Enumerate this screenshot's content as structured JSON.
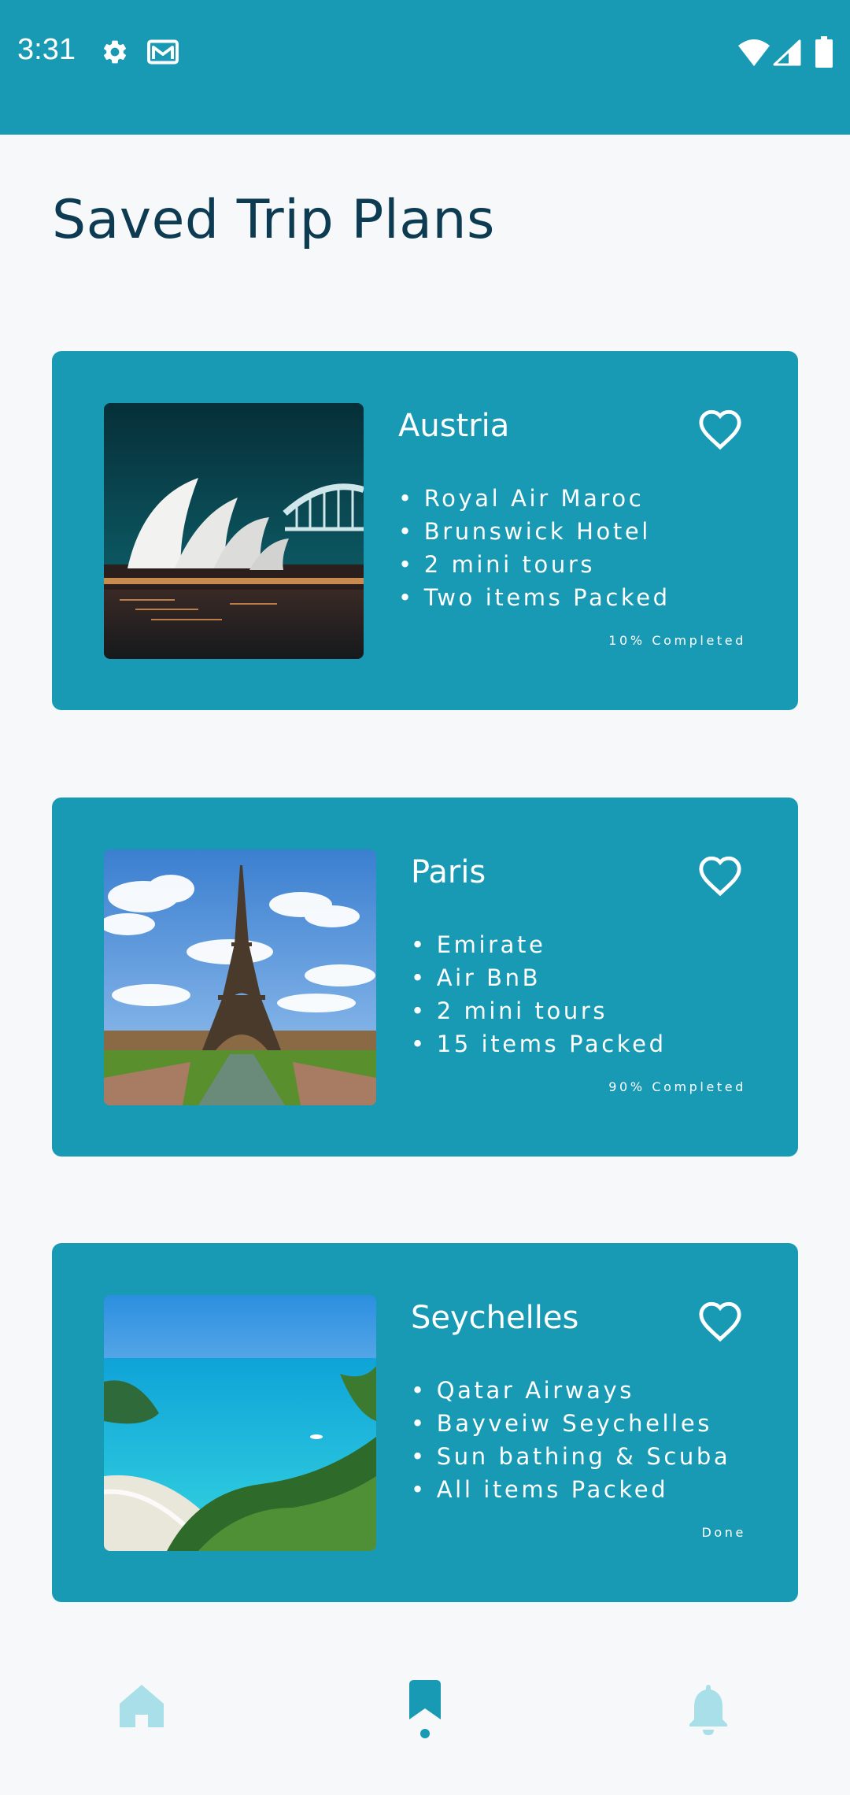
{
  "colors": {
    "accent": "#1899b4",
    "title": "#0c3b52",
    "nav_inactive": "#a9dfe9",
    "nav_active": "#1899b4",
    "background": "#f6f8f9"
  },
  "status_bar": {
    "time": "3:31",
    "icons": [
      "gear-icon",
      "mail-icon",
      "wifi-icon",
      "signal-icon",
      "battery-icon"
    ]
  },
  "page": {
    "title": "Saved Trip Plans"
  },
  "trips": [
    {
      "title": "Austria",
      "image": "sydney-opera-house",
      "items": [
        "Royal Air Maroc",
        "Brunswick Hotel",
        "2 mini tours",
        "Two items Packed"
      ],
      "progress": "10% Completed",
      "favorite_icon": "heart-outline-icon"
    },
    {
      "title": "Paris",
      "image": "eiffel-tower",
      "items": [
        "Emirate",
        "Air BnB",
        "2 mini tours",
        "15 items Packed"
      ],
      "progress": "90% Completed",
      "favorite_icon": "heart-outline-icon"
    },
    {
      "title": "Seychelles",
      "image": "tropical-beach",
      "items": [
        "Qatar Airways",
        "Bayveiw Seychelles",
        "Sun bathing & Scuba",
        "All items Packed"
      ],
      "progress": "Done",
      "favorite_icon": "heart-outline-icon"
    }
  ],
  "bottom_nav": {
    "items": [
      {
        "icon": "home-icon",
        "active": false
      },
      {
        "icon": "bookmark-icon",
        "active": true
      },
      {
        "icon": "bell-icon",
        "active": false
      }
    ]
  }
}
